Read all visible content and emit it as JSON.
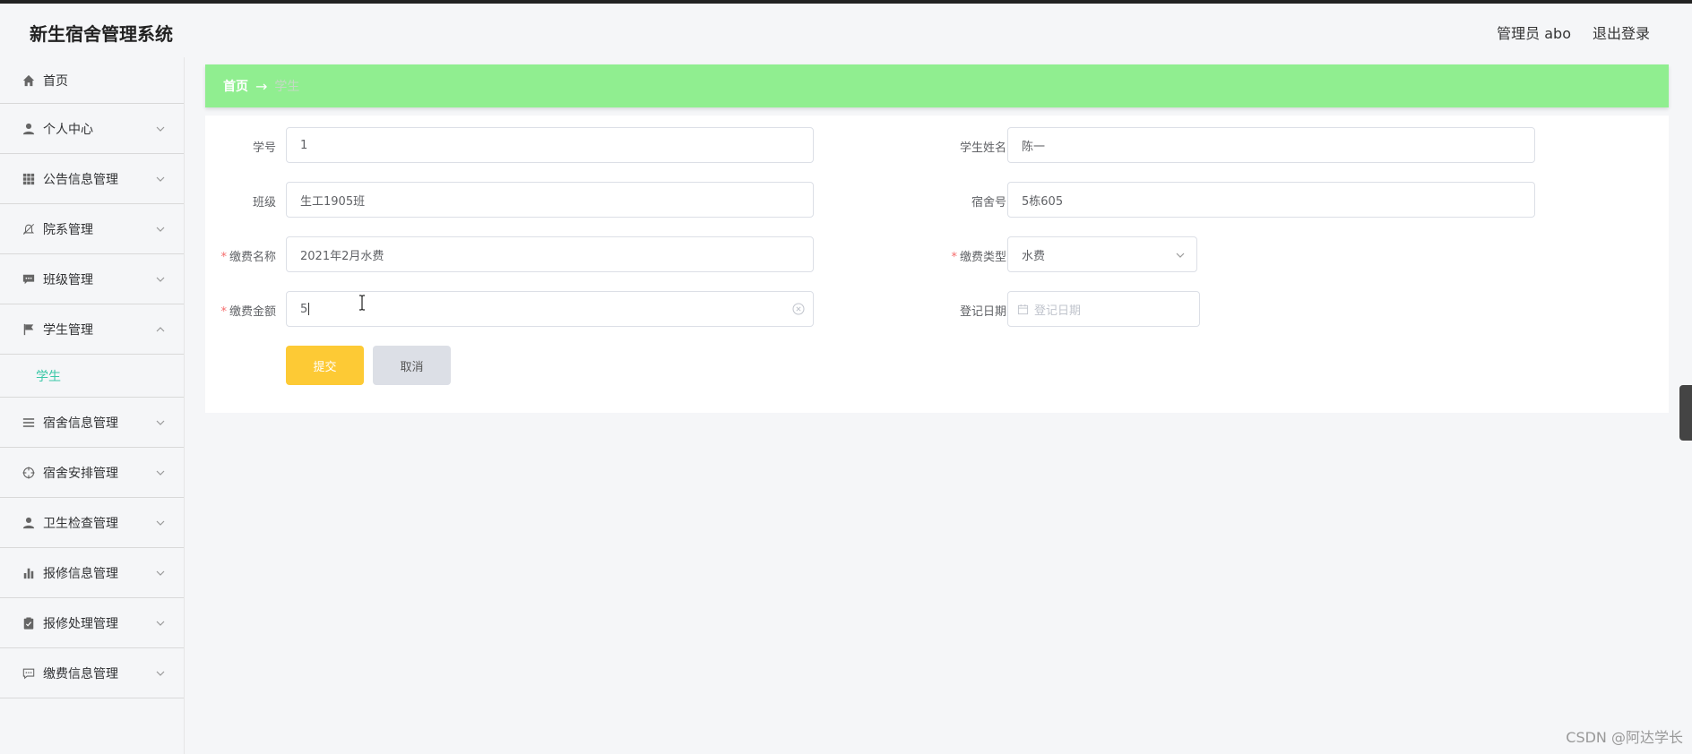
{
  "app": {
    "title": "新生宿舍管理系统",
    "user_label": "管理员 abo",
    "logout_label": "退出登录"
  },
  "sidebar": {
    "items": [
      {
        "label": "首页",
        "icon": "home-icon"
      },
      {
        "label": "个人中心",
        "icon": "user-icon"
      },
      {
        "label": "公告信息管理",
        "icon": "grid-icon"
      },
      {
        "label": "院系管理",
        "icon": "bell-off-icon"
      },
      {
        "label": "班级管理",
        "icon": "chat-icon"
      },
      {
        "label": "学生管理",
        "icon": "flag-icon",
        "expanded": true,
        "children": [
          {
            "label": "学生"
          }
        ]
      },
      {
        "label": "宿舍信息管理",
        "icon": "menu-icon"
      },
      {
        "label": "宿舍安排管理",
        "icon": "target-icon"
      },
      {
        "label": "卫生检查管理",
        "icon": "user-icon"
      },
      {
        "label": "报修信息管理",
        "icon": "bar-chart-icon"
      },
      {
        "label": "报修处理管理",
        "icon": "clipboard-icon"
      },
      {
        "label": "缴费信息管理",
        "icon": "message-icon"
      }
    ]
  },
  "breadcrumb": {
    "home": "首页",
    "separator": "→",
    "current": "学生"
  },
  "form": {
    "student_id": {
      "label": "学号",
      "value": "1"
    },
    "student_name": {
      "label": "学生姓名",
      "value": "陈一"
    },
    "class": {
      "label": "班级",
      "value": "生工1905班"
    },
    "dorm_no": {
      "label": "宿舍号",
      "value": "5栋605"
    },
    "fee_name": {
      "label": "缴费名称",
      "value": "2021年2月水费",
      "required": true
    },
    "fee_type": {
      "label": "缴费类型",
      "value": "水费",
      "required": true
    },
    "fee_amount": {
      "label": "缴费金额",
      "value": "5",
      "required": true
    },
    "reg_date": {
      "label": "登记日期",
      "placeholder": "登记日期"
    },
    "submit_label": "提交",
    "cancel_label": "取消"
  },
  "watermark": "CSDN @阿达学长",
  "colors": {
    "breadcrumb_bg": "#90ee90",
    "submit_bg": "#fdca35",
    "cancel_bg": "#dcdfe6",
    "active_submenu": "#3cc8a8",
    "required": "#f56c6c"
  }
}
